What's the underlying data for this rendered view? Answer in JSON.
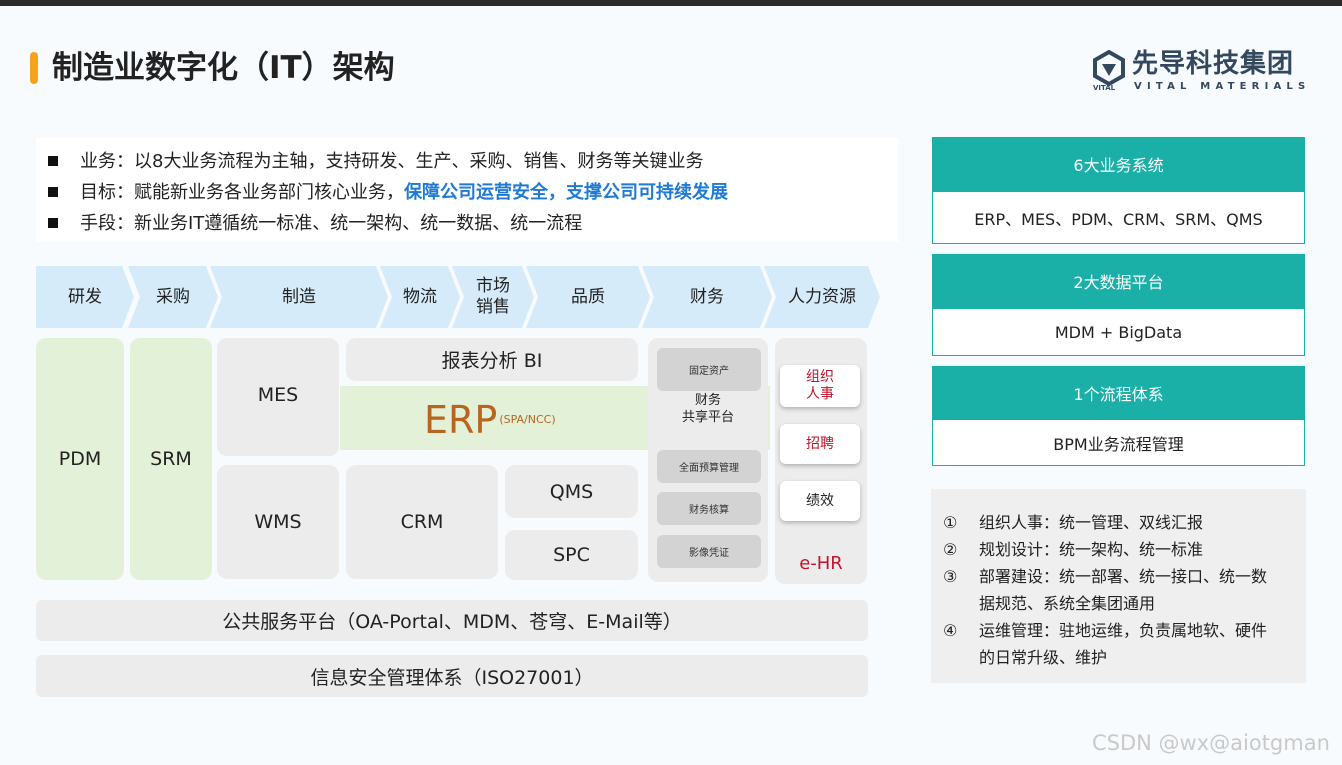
{
  "header": {
    "title": "制造业数字化（IT）架构",
    "logo_cn": "先导科技集团",
    "logo_en": "VITAL MATERIALS",
    "logo_small": "VITAL"
  },
  "bullets": [
    {
      "text": "业务：以8大业务流程为主轴，支持研发、生产、采购、销售、财务等关键业务",
      "highlight": ""
    },
    {
      "text": "目标：赋能新业务各业务部门核心业务，",
      "highlight": "保障公司运营安全，支撑公司可持续发展"
    },
    {
      "text": "手段：新业务IT遵循统一标准、统一架构、统一数据、统一流程",
      "highlight": ""
    }
  ],
  "processes": [
    "研发",
    "采购",
    "制造",
    "物流",
    "市场\n销售",
    "品质",
    "财务",
    "人力资源"
  ],
  "modules": {
    "pdm": "PDM",
    "srm": "SRM",
    "mes": "MES",
    "bi": "报表分析 BI",
    "erp": "ERP",
    "erp_sub": "(SPA/NCC)",
    "wms": "WMS",
    "crm": "CRM",
    "qms": "QMS",
    "spc": "SPC"
  },
  "finance": {
    "fixed_assets": "固定资产",
    "label": "财务\n共享平台",
    "budget": "全面预算管理",
    "accounting": "财务核算",
    "voucher": "影像凭证"
  },
  "hr": {
    "org": "组织\n人事",
    "recruit": "招聘",
    "perf": "绩效",
    "ehr": "e-HR"
  },
  "platforms": {
    "public": "公共服务平台（OA-Portal、MDM、苍穹、E-Mail等）",
    "security": "信息安全管理体系（ISO27001）"
  },
  "systems": [
    {
      "head": "6大业务系统",
      "body": "ERP、MES、PDM、CRM、SRM、QMS"
    },
    {
      "head": "2大数据平台",
      "body": "MDM + BigData"
    },
    {
      "head": "1个流程体系",
      "body": "BPM业务流程管理"
    }
  ],
  "notes": [
    {
      "num": "①",
      "text": "组织人事：统一管理、双线汇报"
    },
    {
      "num": "②",
      "text": "规划设计：统一架构、统一标准"
    },
    {
      "num": "③",
      "text": "部署建设：统一部署、统一接口、统一数据规范、系统全集团通用"
    },
    {
      "num": "④",
      "text": "运维管理：驻地运维，负责属地软、硬件的日常升级、维护"
    }
  ],
  "watermark": "CSDN @wx@aiotgman",
  "colors": {
    "accent": "#f6a21a",
    "teal": "#1ab0a8",
    "erp": "#b8651e",
    "hr_red": "#c0152b",
    "highlight": "#1e7ad4"
  }
}
